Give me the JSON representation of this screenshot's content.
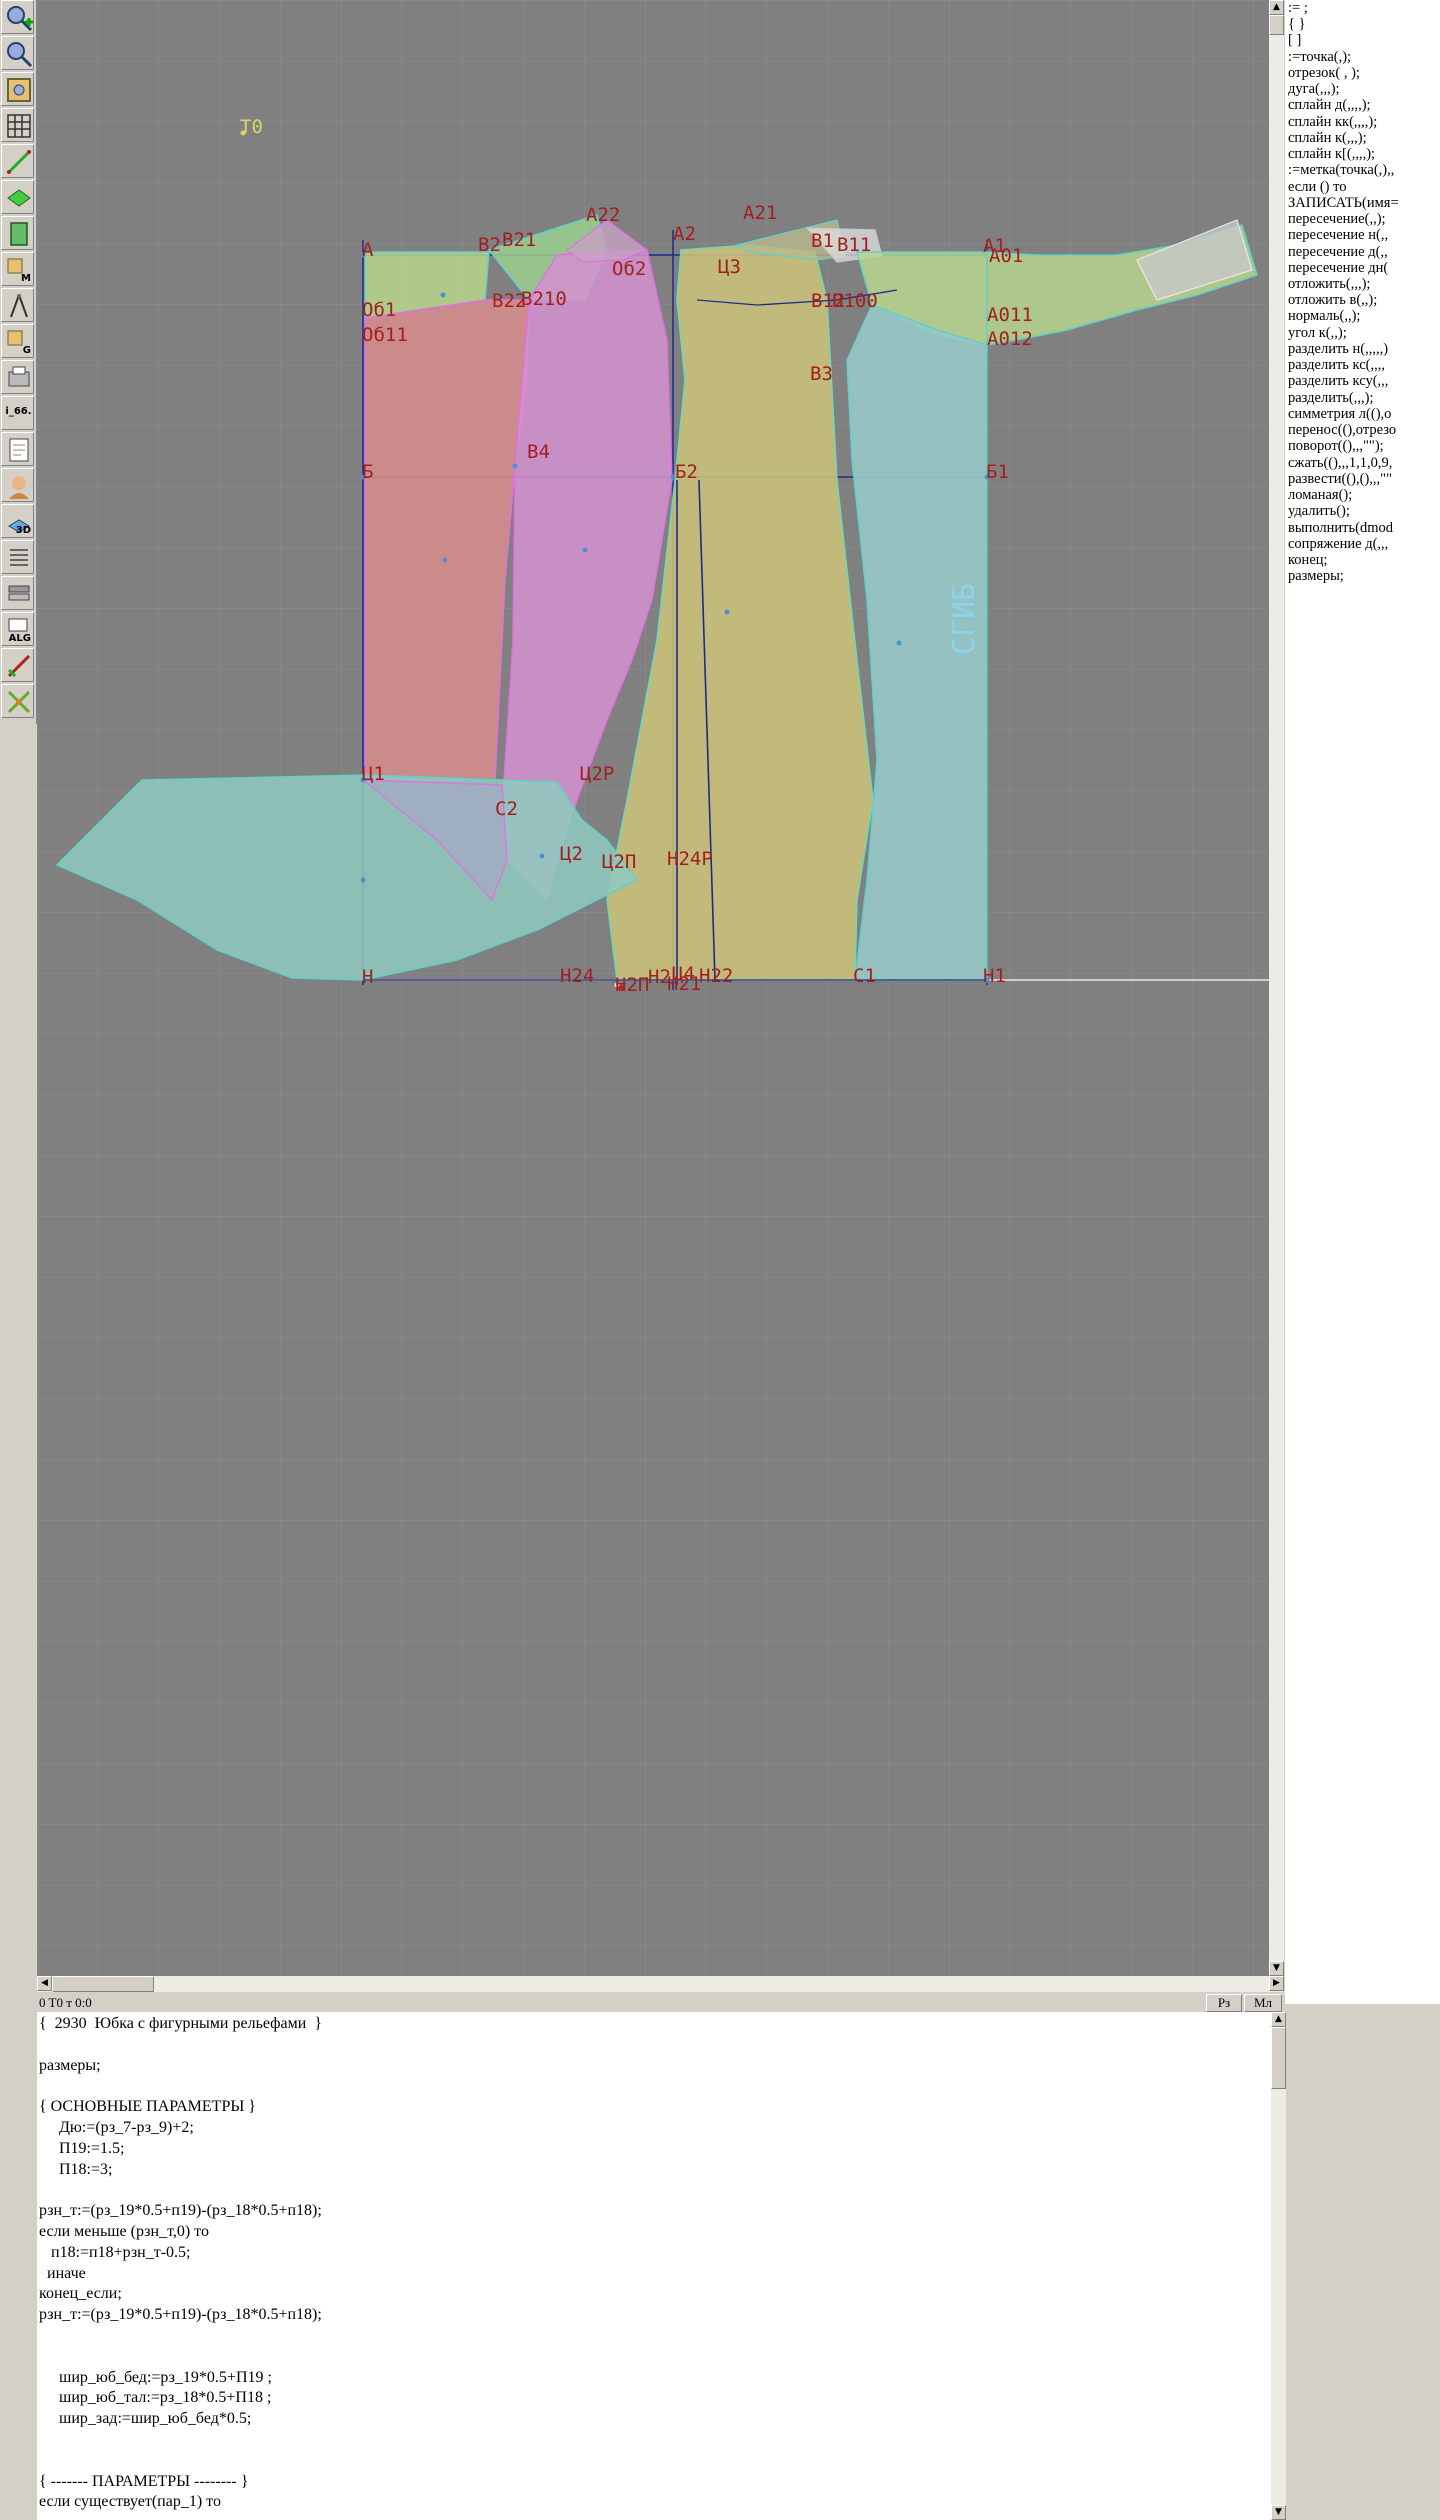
{
  "toolbar": {
    "tools": [
      {
        "name": "zoom-in-icon"
      },
      {
        "name": "zoom-out-icon"
      },
      {
        "name": "zoom-fit-icon"
      },
      {
        "name": "grid-icon"
      },
      {
        "name": "segment-icon"
      },
      {
        "name": "layer-icon"
      },
      {
        "name": "book-icon"
      },
      {
        "name": "macro-icon",
        "sub": "M"
      },
      {
        "name": "compass-icon"
      },
      {
        "name": "gradation-icon",
        "sub": "G"
      },
      {
        "name": "print-icon"
      },
      {
        "name": "version-label",
        "label": "i_66."
      },
      {
        "name": "sheet-icon"
      },
      {
        "name": "user-photo-icon"
      },
      {
        "name": "3d-view-icon",
        "sub": "3D"
      },
      {
        "name": "list-icon"
      },
      {
        "name": "stack-icon"
      },
      {
        "name": "alg-icon",
        "sub": "ALG"
      },
      {
        "name": "measure-icon"
      },
      {
        "name": "cut-icon"
      }
    ]
  },
  "canvas": {
    "point_labels": [
      "T0",
      "А",
      "В2",
      "В21",
      "А22",
      "А2",
      "А21",
      "В1",
      "В11",
      "А1",
      "А01",
      "Об1",
      "Об11",
      "В22",
      "В210",
      "Об2",
      "Ц3",
      "В12",
      "В100",
      "А011",
      "А012",
      "В3",
      "Б",
      "В4",
      "Б2",
      "Б1",
      "Ц1",
      "Ц2Р",
      "Ц2",
      "Ц2П",
      "Н24Р",
      "Н",
      "Н24",
      "Н2",
      "Н22",
      "Н2П",
      "С1",
      "Н1",
      "Ц4",
      "С2",
      "Н21"
    ],
    "rotated_label": "СГИБ",
    "colors": {
      "bg": "#808080",
      "grid": "#8d8d8d",
      "label": "#a31f1f"
    }
  },
  "commands": [
    ":= ;",
    "{ }",
    "[ ]",
    ":=точка(,);",
    "отрезок( , );",
    "дуга(,,,);",
    "сплайн д(,,,,);",
    "сплайн кк(,,,,);",
    "сплайн к(,,,);",
    "сплайн к[(,,,,);",
    ":=метка(точка(,),,",
    "если () то",
    "ЗАПИСАТЬ(имя=",
    "пересечение(,,);",
    "пересечение н(,,",
    "пересечение д(,,",
    "пересечение дн(",
    "отложить(,,,);",
    "отложить в(,,);",
    "нормаль(,,);",
    "угол к(,,);",
    "разделить н(,,,,,)",
    "разделить кс(,,,,",
    "разделить ксу(,,,",
    "разделить(,,,);",
    "симметрия л((),о",
    "перенос((),отрезо",
    "поворот((),,,\"\");",
    "сжать((),,,1,1,0,9,",
    "развести((),(),,,\"\"",
    "ломаная();",
    "удалить();",
    "выполнить(dmod",
    "сопряжение д(,,,",
    "конец;",
    "размеры;"
  ],
  "status": {
    "coord": "0  T0 т 0:0",
    "btn_rz": "Рз",
    "btn_ml": "Мл"
  },
  "editor": {
    "text": "{  2930  Юбка с фигурными рельефами  }\n\nразмеры;\n\n{ ОСНОВНЫЕ ПАРАМЕТРЫ }\n     Дю:=(рз_7-рз_9)+2;\n     П19:=1.5;\n     П18:=3;\n\nрзн_т:=(рз_19*0.5+п19)-(рз_18*0.5+п18);\nесли меньше (рзн_т,0) то\n   п18:=п18+рзн_т-0.5;\n  иначе\nконец_если;\nрзн_т:=(рз_19*0.5+п19)-(рз_18*0.5+п18);\n\n\n     шир_юб_бед:=рз_19*0.5+П19 ;\n     шир_юб_тал:=рз_18*0.5+П18 ;\n     шир_зад:=шир_юб_бед*0.5;\n\n\n{ ------- ПАРАМЕТРЫ -------- }\nесли существует(пар_1) то"
  }
}
